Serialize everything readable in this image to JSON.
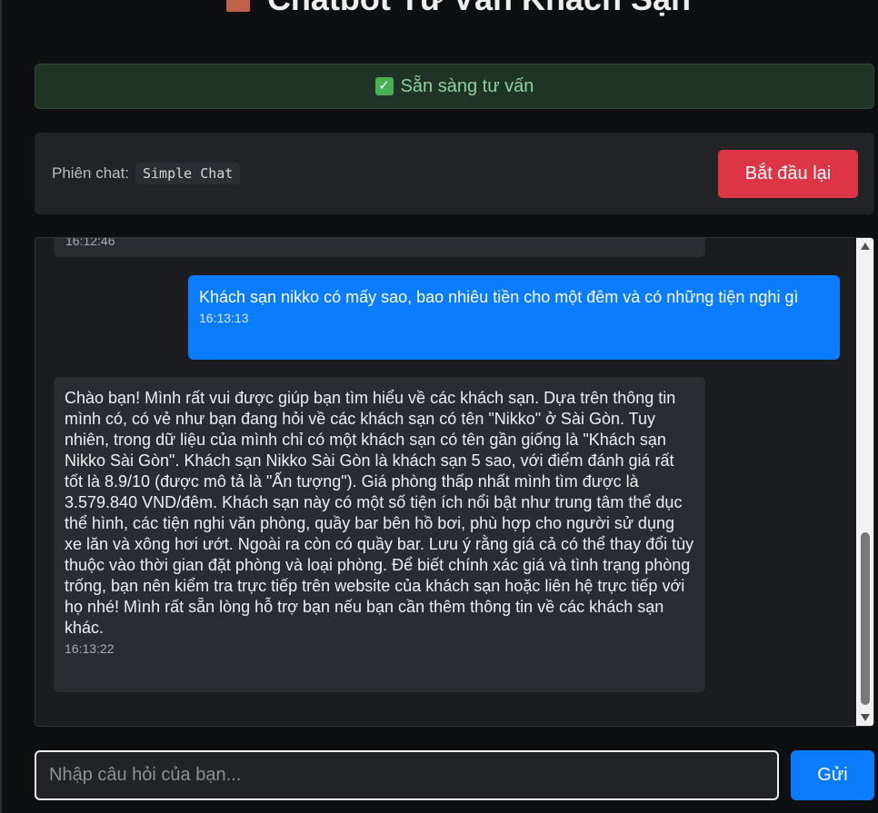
{
  "header": {
    "title": "Chatbot Tư Vấn Khách Sạn",
    "icon": "hotel-icon"
  },
  "status": {
    "icon": "check-icon",
    "text": "Sẵn sàng tư vấn"
  },
  "session": {
    "label": "Phiên chat:",
    "value": "Simple Chat",
    "restart_label": "Bắt đầu lại"
  },
  "messages": [
    {
      "role": "bot",
      "text": "",
      "time": "16:12:46"
    },
    {
      "role": "user",
      "text": "Khách sạn nikko có mấy sao, bao nhiêu tiền cho một đêm và có những tiện nghi gì",
      "time": "16:13:13"
    },
    {
      "role": "bot",
      "text": "Chào bạn! Mình rất vui được giúp bạn tìm hiểu về các khách sạn. Dựa trên thông tin mình có, có vẻ như bạn đang hỏi về các khách sạn có tên \"Nikko\" ở Sài Gòn. Tuy nhiên, trong dữ liệu của mình chỉ có một khách sạn có tên gần giống là \"Khách sạn Nikko Sài Gòn\". Khách sạn Nikko Sài Gòn là khách sạn 5 sao, với điểm đánh giá rất tốt là 8.9/10 (được mô tả là \"Ấn tượng\"). Giá phòng thấp nhất mình tìm được là 3.579.840 VND/đêm. Khách sạn này có một số tiện ích nổi bật như trung tâm thể dục thể hình, các tiện nghi văn phòng, quầy bar bên hồ bơi, phù hợp cho người sử dụng xe lăn và xông hơi ướt. Ngoài ra còn có quầy bar. Lưu ý rằng giá cả có thể thay đổi tùy thuộc vào thời gian đặt phòng và loại phòng. Để biết chính xác giá và tình trạng phòng trống, bạn nên kiểm tra trực tiếp trên website của khách sạn hoặc liên hệ trực tiếp với họ nhé! Mình rất sẵn lòng hỗ trợ bạn nếu bạn cần thêm thông tin về các khách sạn khác.",
      "time": "16:13:22"
    }
  ],
  "input": {
    "placeholder": "Nhập câu hỏi của bạn...",
    "value": ""
  },
  "send_label": "Gửi",
  "colors": {
    "user_bubble": "#0a7cff",
    "bot_bubble": "#2a2c31",
    "restart_button": "#dc3545",
    "status_text": "#8fd19e"
  }
}
